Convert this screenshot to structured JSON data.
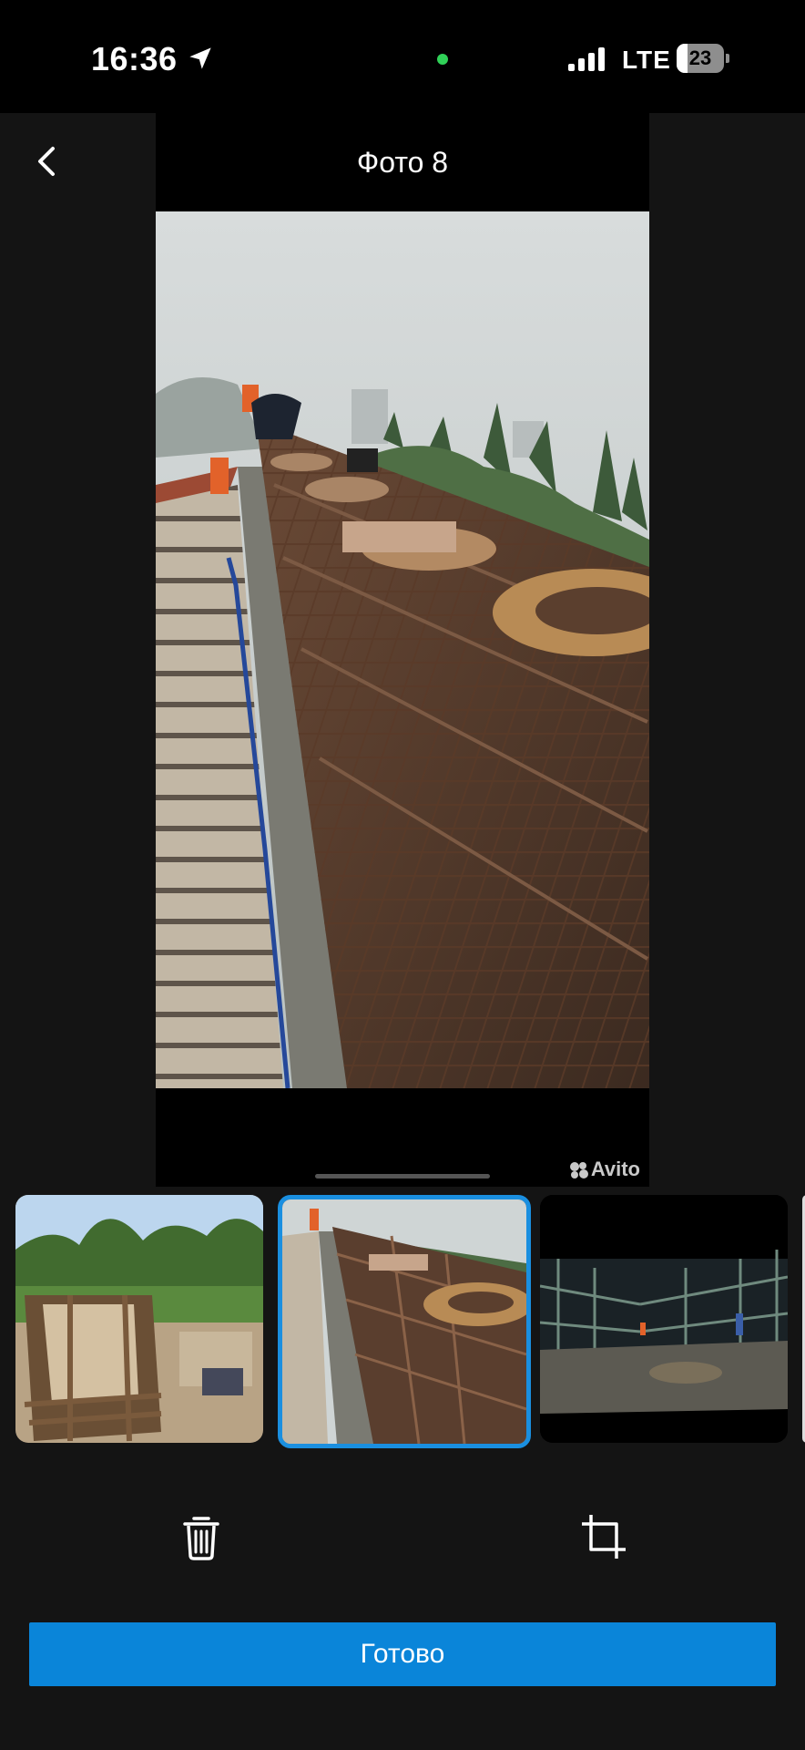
{
  "status_bar": {
    "time": "16:36",
    "network": "LTE",
    "battery_level": "23",
    "battery_fraction": 0.23,
    "icons": [
      "location-arrow-icon",
      "signal-bars-icon",
      "battery-icon"
    ],
    "indicator_color": "#30d158"
  },
  "viewer": {
    "title": "Фото 8",
    "watermark": "Avito",
    "photo": "construction-rebar-cage-photo"
  },
  "thumbnails": [
    {
      "subject": "wooden-formwork-foundation",
      "selected": false
    },
    {
      "subject": "rebar-cage-with-flanges",
      "selected": true
    },
    {
      "subject": "night-scaffolding-site",
      "selected": false
    }
  ],
  "actions": {
    "delete_icon": "trash-icon",
    "crop_icon": "crop-icon",
    "done_label": "Готово"
  },
  "colors": {
    "background": "#141414",
    "accent": "#0a85d9",
    "selected_border": "#1a8fe0"
  }
}
